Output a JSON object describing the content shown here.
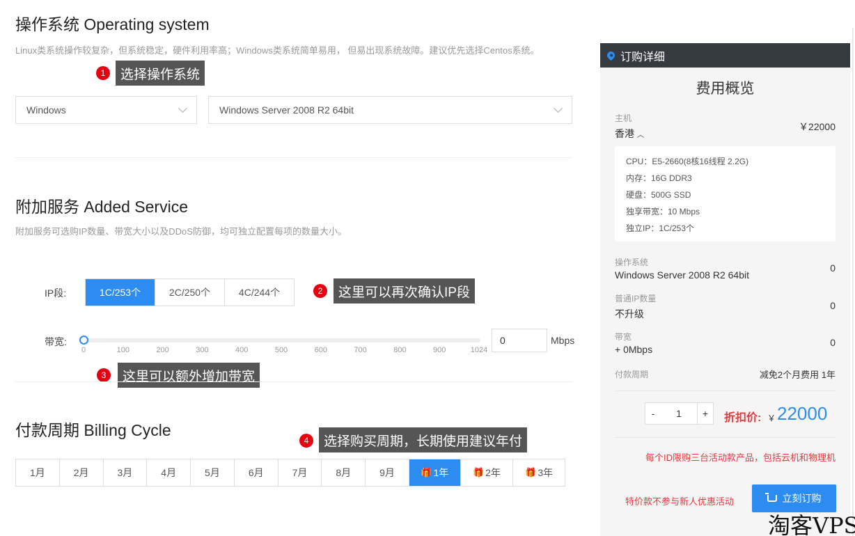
{
  "os": {
    "title": "操作系统 Operating system",
    "desc": "Linux类系统操作较复杂，但系统稳定，硬件利用率高；Windows类系统简单易用， 但易出现系统故障。建议优先选择Centos系统。",
    "type_value": "Windows",
    "version_value": "Windows Server 2008 R2 64bit",
    "tip_num": "1",
    "tip": "选择操作系统"
  },
  "added": {
    "title": "附加服务 Added Service",
    "desc": "附加服务可选购IP数量、带宽大小以及DDoS防御，均可独立配置每项的数量大小。",
    "ip_label": "IP段:",
    "ip_options": [
      "1C/253个",
      "2C/250个",
      "4C/244个"
    ],
    "ip_selected": "1C/253个",
    "ip_tip_num": "2",
    "ip_tip": "这里可以再次确认IP段",
    "bw_label": "带宽:",
    "bw_ticks": [
      "0",
      "100",
      "200",
      "300",
      "400",
      "500",
      "600",
      "700",
      "800",
      "900",
      "1024"
    ],
    "bw_value": "0",
    "bw_level": 0,
    "bw_unit": "Mbps",
    "bw_tip_num": "3",
    "bw_tip": "这里可以额外增加带宽"
  },
  "billing": {
    "title": "付款周期 Billing Cycle",
    "tip_num": "4",
    "tip": "选择购买周期，长期使用建议年付",
    "cycles": [
      "1月",
      "2月",
      "3月",
      "4月",
      "5月",
      "6月",
      "7月",
      "8月",
      "9月",
      "1年",
      "2年",
      "3年"
    ],
    "selected": "1年"
  },
  "order": {
    "header": "订购详细",
    "subtitle": "费用概览",
    "host_label": "主机",
    "host_value": "香港",
    "host_price": "￥22000",
    "specs": [
      "CPU：E5-2660(8核16线程 2.2G)",
      "内存：16G DDR3",
      "硬盘：500G SSD",
      "独享带宽：10 Mbps",
      "独立IP：1C/253个"
    ],
    "os_label": "操作系统",
    "os_value": "Windows Server 2008 R2 64bit",
    "os_price": "0",
    "ip_label": "普通IP数量",
    "ip_value": "不升级",
    "ip_price": "0",
    "bw_label": "带宽",
    "bw_value": "+ 0Mbps",
    "bw_price": "0",
    "period_label": "付款周期",
    "period_value": "减免2个月费用 1年",
    "qty": "1",
    "minus": "-",
    "plus": "+",
    "discount_label": "折扣价:",
    "currency": "￥",
    "total": "22000",
    "notice": "每个ID限购三台活动款产品，包括云机和物理机",
    "notice2": "特价款不参与新人优惠活动",
    "buy_label": "立刻订购"
  },
  "watermark": "淘客VPS",
  "colors": {
    "accent": "#2d8cf0",
    "badge": "#e60012",
    "tip_bg": "#555555",
    "panel_header": "#353a40"
  }
}
